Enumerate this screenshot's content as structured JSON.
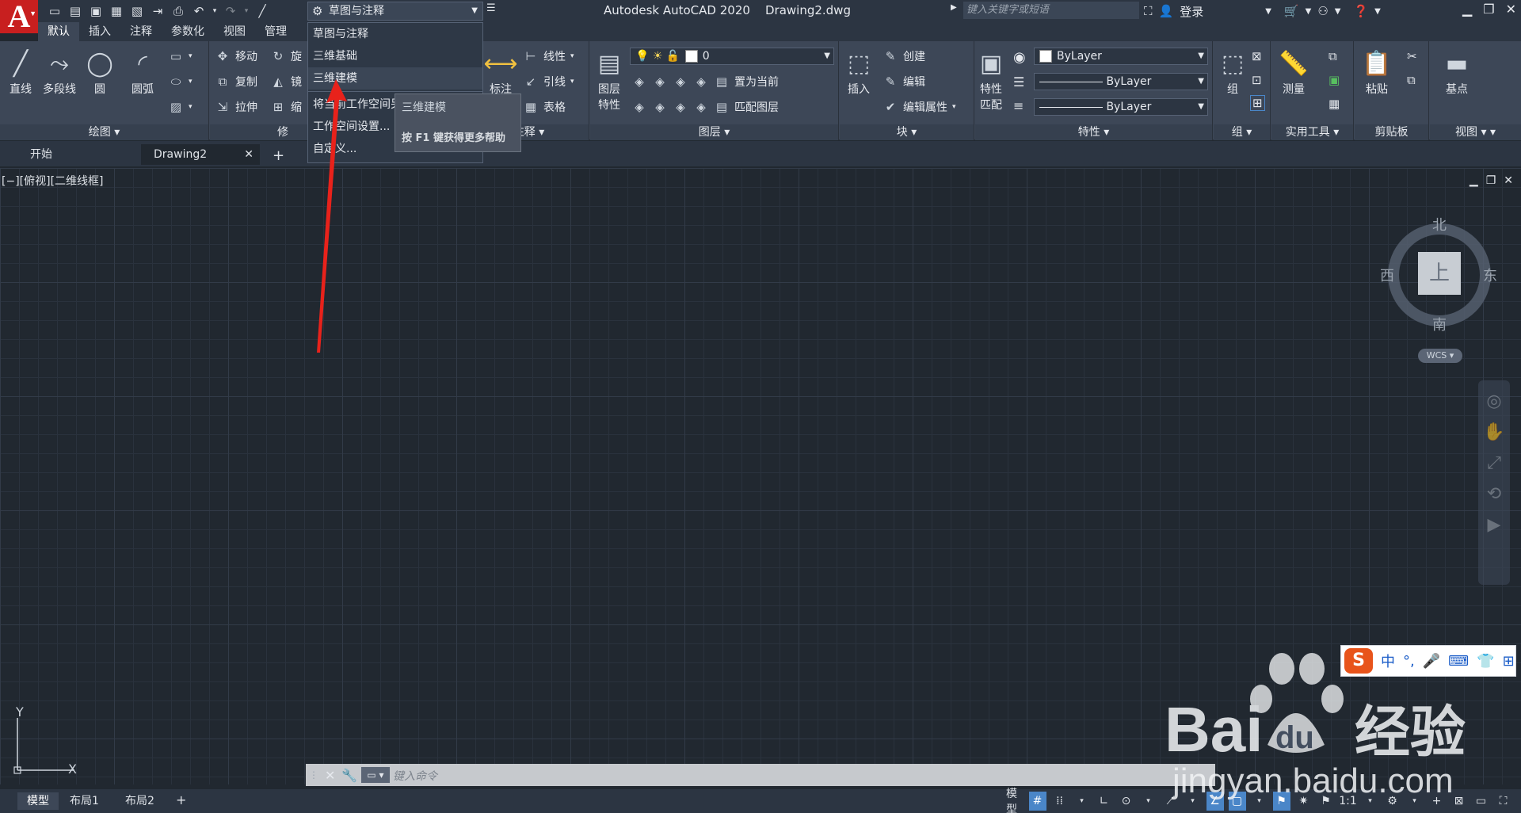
{
  "app": {
    "logo_letter": "A",
    "title": "Autodesk AutoCAD 2020    Drawing2.dwg",
    "search_placeholder": "键入关键字或短语",
    "login_label": "登录"
  },
  "workspace": {
    "current": "草图与注释",
    "menu_items": [
      "草图与注释",
      "三维基础",
      "三维建模",
      "将当前工作空间另存为...",
      "工作空间设置...",
      "自定义..."
    ],
    "tooltip_title": "三维建模",
    "tooltip_help": "按 F1 键获得更多帮助"
  },
  "ribbon": {
    "tabs": [
      "默认",
      "插入",
      "注释",
      "参数化",
      "视图",
      "管理"
    ],
    "draw": {
      "title": "绘图",
      "line": "直线",
      "polyline": "多段线",
      "circle": "圆",
      "arc": "圆弧"
    },
    "modify": {
      "move": "移动",
      "copy": "复制",
      "stretch": "拉伸",
      "rotate": "旋",
      "mirror": "镜",
      "scale": "缩",
      "title_fragment": "修"
    },
    "annotation": {
      "title": "注释",
      "dimension": "标注",
      "linear": "线性",
      "leader": "引线",
      "table": "表格"
    },
    "layers": {
      "title": "图层",
      "layer_properties": "图层\n特性",
      "layer_properties_1": "图层",
      "layer_properties_2": "特性",
      "current_layer": "0",
      "set_current": "置为当前",
      "match_layer": "匹配图层"
    },
    "block": {
      "title": "块",
      "insert": "插入",
      "create": "创建",
      "edit": "编辑",
      "edit_attributes": "编辑属性"
    },
    "properties": {
      "title": "特性",
      "match_1": "特性",
      "match_2": "匹配",
      "color": "ByLayer",
      "linetype": "ByLayer",
      "lineweight": "ByLayer"
    },
    "groups": {
      "title": "组",
      "group": "组"
    },
    "utilities": {
      "title": "实用工具",
      "measure": "测量"
    },
    "clipboard": {
      "title": "剪贴板",
      "paste": "粘贴"
    },
    "view": {
      "title": "视图",
      "base": "基点"
    }
  },
  "file_tabs": {
    "start": "开始",
    "drawing": "Drawing2"
  },
  "viewport": {
    "label": "[−][俯视][二维线框]",
    "viewcube": {
      "north": "北",
      "south": "南",
      "east": "东",
      "west": "西",
      "face": "上",
      "wcs": "WCS"
    },
    "ucs_x": "X",
    "ucs_y": "Y"
  },
  "command": {
    "placeholder": "键入命令"
  },
  "status": {
    "layout_tabs": [
      "模型",
      "布局1",
      "布局2"
    ],
    "model_label": "模型",
    "scale": "1:1"
  },
  "ime": {
    "mode": "中",
    "punct": "°,"
  },
  "watermark": {
    "brand": "Bai",
    "brand2": "du",
    "suffix": "经验",
    "url": "jingyan.baidu.com"
  },
  "colors": {
    "ribbon_bg": "#3d4757",
    "canvas_bg": "#212830",
    "accent_blue": "#4a86c8",
    "annotation_red": "#e8221b",
    "logo_red": "#c81f1f"
  }
}
